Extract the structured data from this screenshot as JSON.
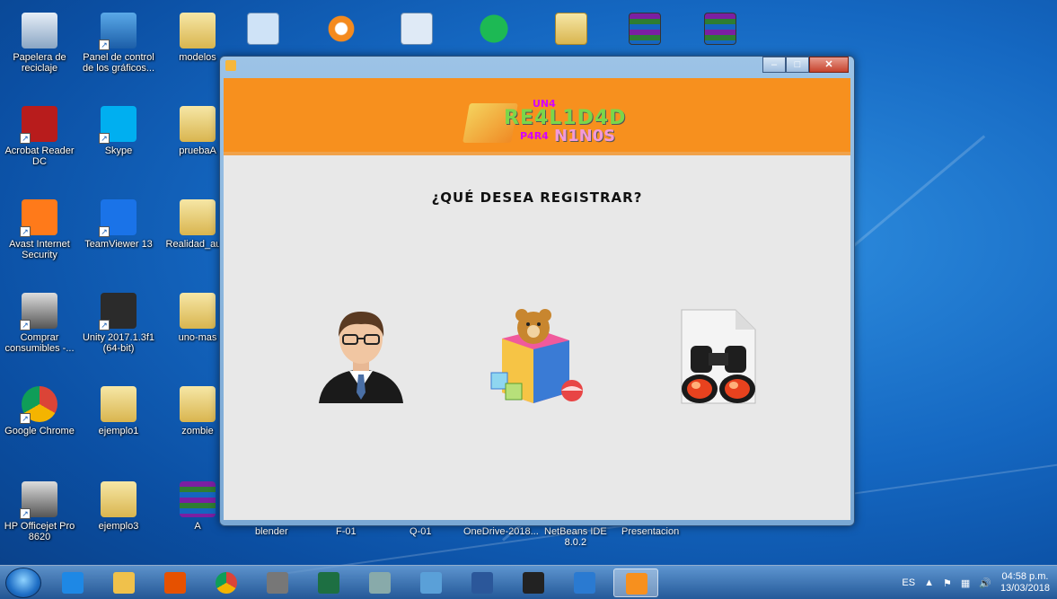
{
  "desktop": {
    "icons": [
      {
        "label": "Papelera de\nreciclaje",
        "icon": "recycle-bin-icon"
      },
      {
        "label": "Panel de control\nde los gráficos...",
        "icon": "intel-graphics-icon"
      },
      {
        "label": "modelos",
        "icon": "folder-icon"
      },
      {
        "label": "Acrobat Reader\nDC",
        "icon": "acrobat-icon"
      },
      {
        "label": "Skype",
        "icon": "skype-icon"
      },
      {
        "label": "pruebaA",
        "icon": "folder-icon"
      },
      {
        "label": "Avast Internet\nSecurity",
        "icon": "avast-icon"
      },
      {
        "label": "TeamViewer 13",
        "icon": "teamviewer-icon"
      },
      {
        "label": "Realidad_aum",
        "icon": "folder-icon"
      },
      {
        "label": "Comprar\nconsumibles -...",
        "icon": "printer-icon"
      },
      {
        "label": "Unity 2017.1.3f1\n(64-bit)",
        "icon": "unity-icon"
      },
      {
        "label": "uno-mas",
        "icon": "folder-icon"
      },
      {
        "label": "Google Chrome",
        "icon": "chrome-icon"
      },
      {
        "label": "ejemplo1",
        "icon": "folder-icon"
      },
      {
        "label": "zombie",
        "icon": "folder-icon"
      },
      {
        "label": "HP Officejet Pro\n8620",
        "icon": "printer-icon"
      },
      {
        "label": "ejemplo3",
        "icon": "folder-icon"
      },
      {
        "label": "A",
        "icon": "winrar-icon"
      }
    ],
    "behind_window_labels": [
      "blender",
      "F-01",
      "Q-01",
      "OneDrive-2018...",
      "NetBeans IDE\n8.0.2",
      "Presentacion"
    ]
  },
  "app": {
    "logo": {
      "line1": "UN4",
      "line2": "RE4L1D4D",
      "line3": "P4R4",
      "line4": "N1N0S"
    },
    "question": "¿QUÉ DESEA REGISTRAR?",
    "options": [
      {
        "name": "teacher-user-option",
        "icon": "businessman-icon"
      },
      {
        "name": "children-option",
        "icon": "toy-box-icon"
      },
      {
        "name": "search-option",
        "icon": "binoculars-icon"
      }
    ]
  },
  "taskbar": {
    "items": [
      "ie-icon",
      "explorer-icon",
      "media-player-icon",
      "chrome-icon",
      "scanner-icon",
      "excel-icon",
      "snipping-icon",
      "photo-viewer-icon",
      "word-icon",
      "unity-icon",
      "vscode-icon",
      "app-icon"
    ],
    "active_index": 11,
    "tray": {
      "lang": "ES",
      "time": "04:58 p.m.",
      "date": "13/03/2018"
    }
  },
  "colors": {
    "banner": "#f7901e",
    "client_bg": "#e8e8e8"
  }
}
